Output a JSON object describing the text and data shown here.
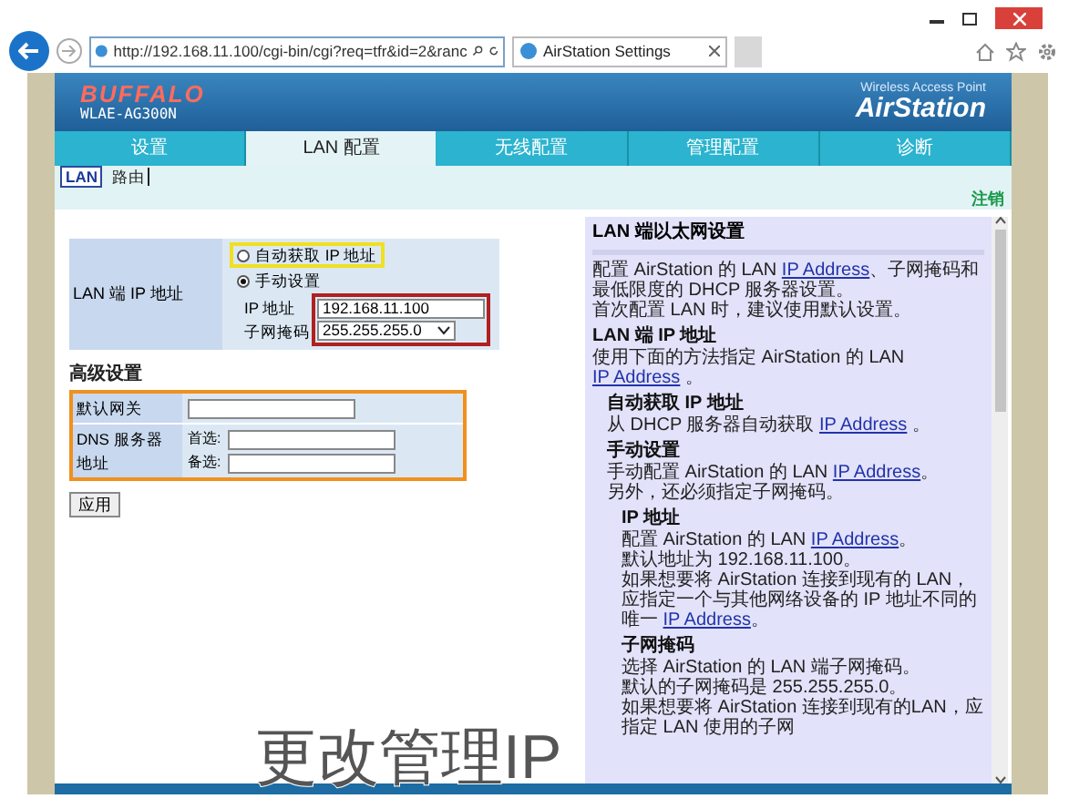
{
  "browser": {
    "url": "http://192.168.11.100/cgi-bin/cgi?req=tfr&id=2&ranc",
    "tab_title": "AirStation Settings"
  },
  "header": {
    "brand": "BUFFALO",
    "model": "WLAE-AG300N",
    "tagline": "Wireless Access Point",
    "product": "AirStation"
  },
  "tabs": [
    {
      "label": "设置",
      "selected": false
    },
    {
      "label": "LAN 配置",
      "selected": true
    },
    {
      "label": "无线配置",
      "selected": false
    },
    {
      "label": "管理配置",
      "selected": false
    },
    {
      "label": "诊断",
      "selected": false
    }
  ],
  "subtabs": [
    {
      "label": "LAN",
      "selected": true
    },
    {
      "label": "路由",
      "selected": false
    }
  ],
  "logout": "注销",
  "lan_ip": {
    "label": "LAN 端 IP 地址",
    "options": [
      {
        "label": "自动获取 IP 地址",
        "selected": false,
        "highlighted": true
      },
      {
        "label": "手动设置",
        "selected": true,
        "highlighted": false
      }
    ],
    "ip_label": "IP 地址",
    "ip_value": "192.168.11.100",
    "mask_label": "子网掩码",
    "mask_value": "255.255.255.0"
  },
  "advanced": {
    "title": "高级设置",
    "gateway_label": "默认网关",
    "dns_label": "DNS 服务器地址",
    "primary_label": "首选:",
    "secondary_label": "备选:"
  },
  "apply_button": "应用",
  "help": {
    "title": "LAN 端以太网设置",
    "paragraphs": [
      [
        {
          "kind": "text",
          "text": "配置 AirStation 的 LAN "
        },
        {
          "kind": "link",
          "text": "IP Address"
        },
        {
          "kind": "text",
          "text": "、子网掩码和最低限度的 DHCP 服务器设置。"
        }
      ],
      [
        {
          "kind": "text",
          "text": "首次配置 LAN 时，建议使用默认设置。"
        }
      ]
    ],
    "sections": [
      {
        "heading": "LAN 端 IP 地址",
        "paragraphs": [
          [
            {
              "kind": "text",
              "text": "使用下面的方法指定 AirStation 的 LAN "
            },
            {
              "kind": "link",
              "text": "IP Address"
            },
            {
              "kind": "text",
              "text": " 。"
            }
          ]
        ],
        "children": [
          {
            "heading": "自动获取 IP 地址",
            "paragraphs": [
              [
                {
                  "kind": "text",
                  "text": "从 DHCP 服务器自动获取 "
                },
                {
                  "kind": "link",
                  "text": "IP Address"
                },
                {
                  "kind": "text",
                  "text": " 。"
                }
              ]
            ]
          },
          {
            "heading": "手动设置",
            "paragraphs": [
              [
                {
                  "kind": "text",
                  "text": "手动配置 AirStation 的 LAN "
                },
                {
                  "kind": "link",
                  "text": "IP Address"
                },
                {
                  "kind": "text",
                  "text": "。"
                }
              ],
              [
                {
                  "kind": "text",
                  "text": "另外，还必须指定子网掩码。"
                }
              ]
            ],
            "children": [
              {
                "heading": "IP 地址",
                "paragraphs": [
                  [
                    {
                      "kind": "text",
                      "text": "配置 AirStation 的 LAN "
                    },
                    {
                      "kind": "link",
                      "text": "IP Address"
                    },
                    {
                      "kind": "text",
                      "text": "。"
                    }
                  ],
                  [
                    {
                      "kind": "text",
                      "text": "默认地址为 192.168.11.100。"
                    }
                  ],
                  [
                    {
                      "kind": "text",
                      "text": "如果想要将 AirStation 连接到现有的 LAN，应指定一个与其他网络设备的 IP 地址不同的唯一 "
                    },
                    {
                      "kind": "link",
                      "text": "IP Address"
                    },
                    {
                      "kind": "text",
                      "text": "。"
                    }
                  ]
                ]
              },
              {
                "heading": "子网掩码",
                "paragraphs": [
                  [
                    {
                      "kind": "text",
                      "text": "选择 AirStation 的 LAN 端子网掩码。"
                    }
                  ],
                  [
                    {
                      "kind": "text",
                      "text": "默认的子网掩码是 255.255.255.0。"
                    }
                  ],
                  [
                    {
                      "kind": "text",
                      "text": "如果想要将 AirStation 连接到现有的LAN，应指定 LAN 使用的子网"
                    }
                  ]
                ]
              }
            ]
          }
        ]
      }
    ]
  },
  "caption": "更改管理IP"
}
